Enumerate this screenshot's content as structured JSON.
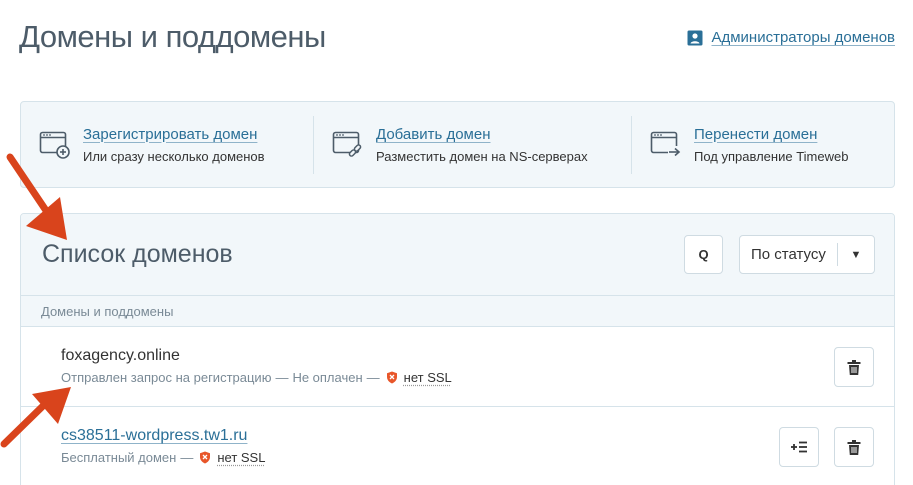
{
  "header": {
    "title": "Домены и поддомены",
    "admin_link": "Администраторы доменов"
  },
  "actions": [
    {
      "title": "Зарегистрировать домен",
      "subtitle": "Или сразу несколько доменов",
      "icon": "browser-plus-icon"
    },
    {
      "title": "Добавить домен",
      "subtitle": "Разместить домен на NS-серверах",
      "icon": "browser-link-icon"
    },
    {
      "title": "Перенести домен",
      "subtitle": "Под управление Timeweb",
      "icon": "browser-transfer-icon"
    }
  ],
  "list": {
    "title": "Список доменов",
    "search_icon": "Q",
    "filter": {
      "selected": "По статусу",
      "arrow": "▼"
    },
    "group_header": "Домены и поддомены",
    "domains": [
      {
        "name": "foxagency.online",
        "status": "Отправлен запрос на регистрацию",
        "payment": "Не оплачен",
        "dash": "—",
        "ssl": "нет SSL"
      },
      {
        "name": "cs38511-wordpress.tw1.ru",
        "status": "Бесплатный домен",
        "dash": "—",
        "ssl": "нет SSL"
      }
    ]
  },
  "colors": {
    "accent": "#2a6f97",
    "panel_bg": "#f2f7fa",
    "border": "#d6e3ea",
    "annotation_arrow": "#d9441c",
    "ssl_shield": "#e8562a"
  }
}
